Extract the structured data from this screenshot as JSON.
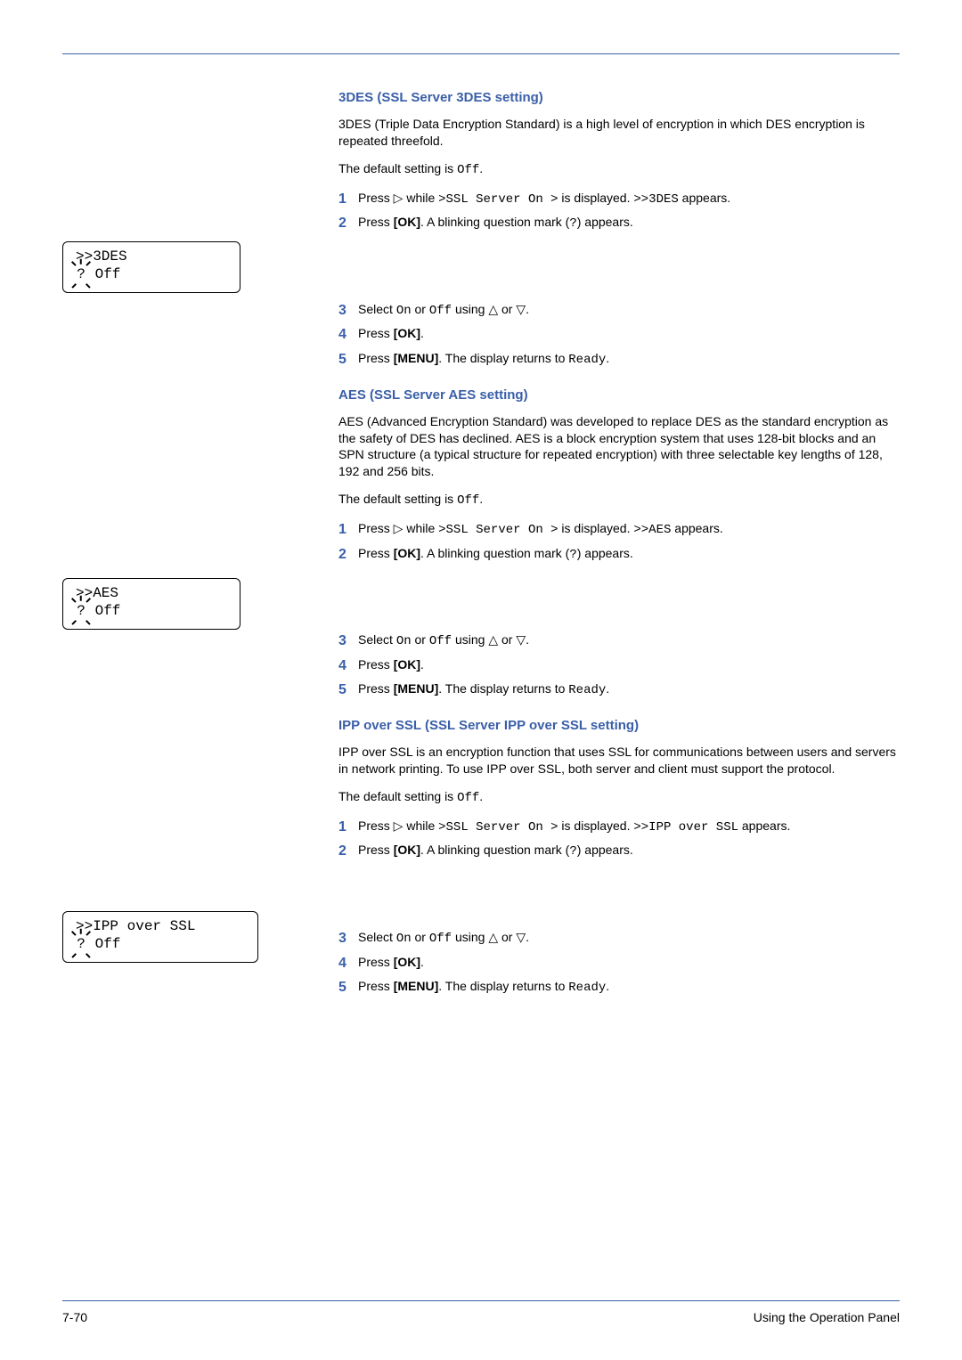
{
  "sections": {
    "s1": {
      "heading": "3DES (SSL Server 3DES setting)",
      "p1": "3DES (Triple Data Encryption Standard) is a high level of encryption in which DES encryption is repeated threefold.",
      "p2_a": "The default setting is ",
      "p2_b": "Off",
      "p2_c": ".",
      "steps": {
        "n1": "1",
        "t1_a": "Press ▷ while ",
        "t1_b": ">SSL Server On >",
        "t1_c": " is displayed. ",
        "t1_d": ">>3DES",
        "t1_e": " appears.",
        "n2": "2",
        "t2_a": "Press ",
        "t2_b": "[OK]",
        "t2_c": ". A blinking question mark (",
        "t2_d": "?",
        "t2_e": ") appears.",
        "n3": "3",
        "t3_a": "Select ",
        "t3_b": "On",
        "t3_c": " or ",
        "t3_d": "Off",
        "t3_e": " using △ or ▽.",
        "n4": "4",
        "t4_a": "Press ",
        "t4_b": "[OK]",
        "t4_c": ".",
        "n5": "5",
        "t5_a": "Press ",
        "t5_b": "[MENU]",
        "t5_c": ". The display returns to ",
        "t5_d": "Ready",
        "t5_e": "."
      },
      "display": {
        "line1": ">>3DES",
        "q": "?",
        "line2": " Off"
      }
    },
    "s2": {
      "heading": "AES (SSL Server AES setting)",
      "p1": "AES (Advanced Encryption Standard) was developed to replace DES as the standard encryption as the safety of DES has declined. AES is a block encryption system that uses 128-bit blocks and an SPN structure (a typical structure for repeated encryption) with three selectable key lengths of 128, 192 and 256 bits.",
      "p2_a": "The default setting is ",
      "p2_b": "Off",
      "p2_c": ".",
      "steps": {
        "n1": "1",
        "t1_a": "Press ▷ while ",
        "t1_b": ">SSL Server On >",
        "t1_c": " is displayed. ",
        "t1_d": ">>AES",
        "t1_e": " appears.",
        "n2": "2",
        "t2_a": "Press ",
        "t2_b": "[OK]",
        "t2_c": ". A blinking question mark (",
        "t2_d": "?",
        "t2_e": ") appears.",
        "n3": "3",
        "t3_a": "Select ",
        "t3_b": "On",
        "t3_c": " or ",
        "t3_d": "Off",
        "t3_e": " using △ or ▽.",
        "n4": "4",
        "t4_a": "Press ",
        "t4_b": "[OK]",
        "t4_c": ".",
        "n5": "5",
        "t5_a": "Press ",
        "t5_b": "[MENU]",
        "t5_c": ". The display returns to ",
        "t5_d": "Ready",
        "t5_e": "."
      },
      "display": {
        "line1": ">>AES",
        "q": "?",
        "line2": " Off"
      }
    },
    "s3": {
      "heading": "IPP over SSL (SSL Server IPP over SSL setting)",
      "p1": "IPP over SSL is an encryption function that uses SSL for communications between users and servers in network printing. To use IPP over SSL, both server and client must support the protocol.",
      "p2_a": "The default setting is ",
      "p2_b": "Off",
      "p2_c": ".",
      "steps": {
        "n1": "1",
        "t1_a": "Press ▷ while ",
        "t1_b": ">SSL Server On >",
        "t1_c": " is displayed. ",
        "t1_d": ">>IPP over SSL",
        "t1_e": " appears.",
        "n2": "2",
        "t2_a": "Press ",
        "t2_b": "[OK]",
        "t2_c": ". A blinking question mark (",
        "t2_d": "?",
        "t2_e": ") appears.",
        "n3": "3",
        "t3_a": "Select ",
        "t3_b": "On",
        "t3_c": " or ",
        "t3_d": "Off",
        "t3_e": " using △ or ▽.",
        "n4": "4",
        "t4_a": "Press ",
        "t4_b": "[OK]",
        "t4_c": ".",
        "n5": "5",
        "t5_a": "Press ",
        "t5_b": "[MENU]",
        "t5_c": ". The display returns to ",
        "t5_d": "Ready",
        "t5_e": "."
      },
      "display": {
        "line1": ">>IPP over SSL",
        "q": "?",
        "line2": " Off"
      }
    }
  },
  "footer": {
    "page": "7-70",
    "title": "Using the Operation Panel"
  }
}
